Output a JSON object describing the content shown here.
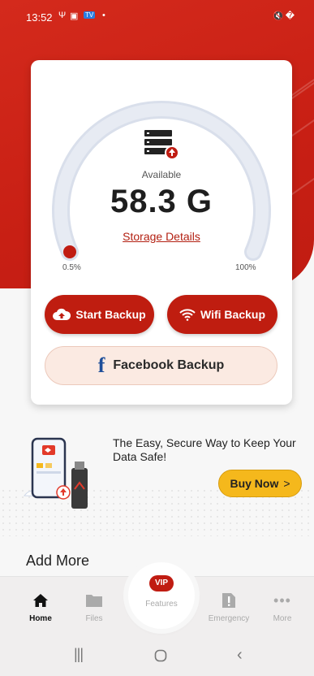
{
  "status_bar": {
    "time": "13:52",
    "icons_left": [
      "usb-icon",
      "image-icon",
      "tv-app-icon",
      "dot-icon"
    ],
    "icons_right": [
      "mute-icon",
      "wifi-icon",
      "signal-icon",
      "battery-icon"
    ]
  },
  "storage": {
    "available_label": "Available",
    "value": "58.3 G",
    "details_link": "Storage Details",
    "min_label": "0.5%",
    "max_label": "100%",
    "used_fraction": 0.005
  },
  "actions": {
    "start_backup": "Start Backup",
    "wifi_backup": "Wifi Backup",
    "facebook_backup": "Facebook Backup"
  },
  "promo": {
    "text": "The Easy, Secure Way to Keep Your Data Safe!",
    "buy_now": "Buy Now",
    "buy_arrow": ">"
  },
  "section": {
    "add_more": "Add More"
  },
  "nav": {
    "home": "Home",
    "files": "Files",
    "vip_badge": "VIP",
    "features": "Features",
    "emergency": "Emergency",
    "more": "More"
  },
  "colors": {
    "brand_red": "#c01c12",
    "accent_yellow": "#f5b81c",
    "facebook_blue": "#1f4f9a"
  }
}
